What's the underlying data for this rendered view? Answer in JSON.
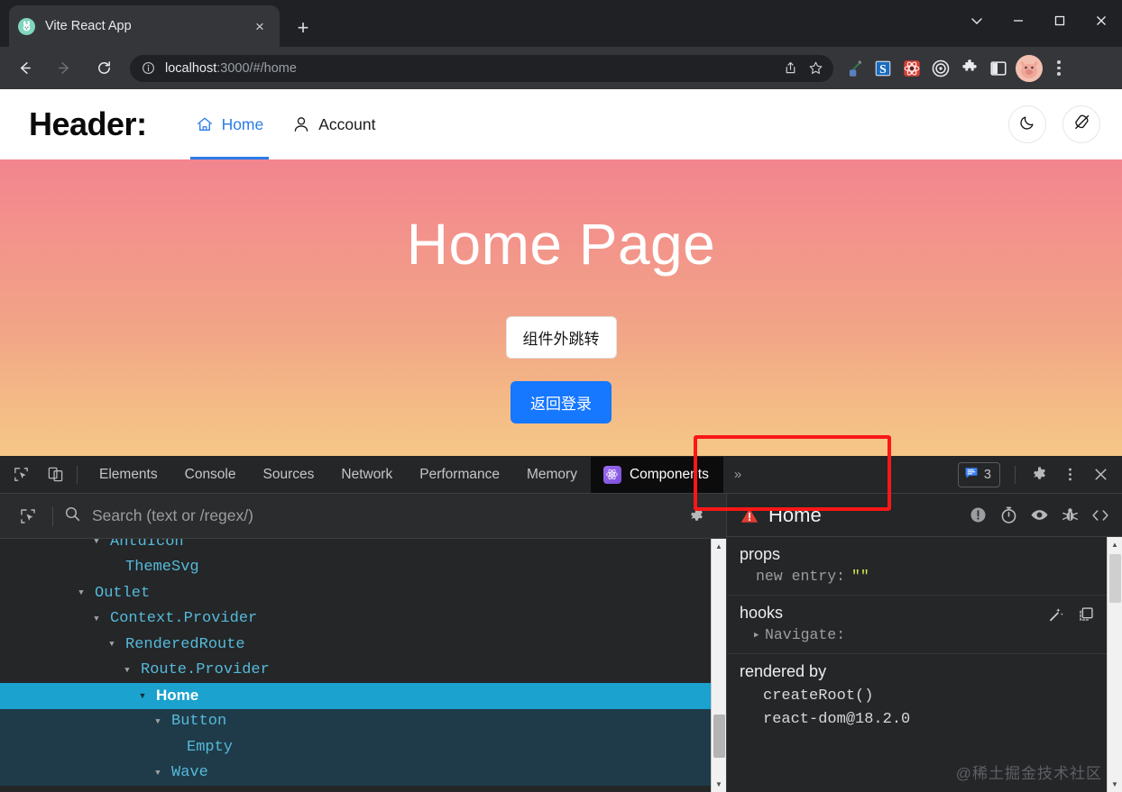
{
  "browser": {
    "tab": {
      "title": "Vite React App",
      "favicon": "rabbit-favicon",
      "close_label": "×"
    },
    "new_tab_label": "+",
    "window_controls": [
      "chevron-down",
      "minimize",
      "maximize",
      "close"
    ],
    "omnibox": {
      "url_host": "localhost",
      "url_rest": ":3000/#/home",
      "info_icon": "info-circle-icon"
    },
    "toolbar_actions": [
      "share-icon",
      "bookmark-star-icon"
    ],
    "extensions": [
      "eyedropper-icon",
      "stylus-s-icon",
      "react-devtools-icon",
      "target-icon",
      "puzzle-icon",
      "sidepanel-icon"
    ],
    "profile": "pig-avatar",
    "menu": "kebab-menu"
  },
  "app": {
    "logo": "Header:",
    "nav": [
      {
        "label": "Home",
        "icon": "home-icon",
        "active": true
      },
      {
        "label": "Account",
        "icon": "user-icon",
        "active": false
      }
    ],
    "header_actions": [
      {
        "name": "dark-mode-toggle",
        "icon": "moon-icon"
      },
      {
        "name": "theme-picker",
        "icon": "brush-icon"
      }
    ],
    "hero": {
      "title": "Home Page",
      "button_outline": "组件外跳转",
      "button_primary": "返回登录"
    },
    "colors": {
      "hero_gradient_top": "#f2858f",
      "hero_gradient_bottom": "#f5c787",
      "primary": "#1677ff",
      "nav_active": "#2b7ce8"
    }
  },
  "devtools": {
    "left_tools": [
      "inspect-element-icon",
      "device-toolbar-icon"
    ],
    "tabs": [
      "Elements",
      "Console",
      "Sources",
      "Network",
      "Performance",
      "Memory"
    ],
    "active_tab": {
      "label": "Components",
      "icon": "react-atom-icon"
    },
    "overflow_label": "»",
    "issues_count": "3",
    "right_icons": [
      "settings-gear-icon",
      "kebab-menu-icon",
      "close-icon"
    ],
    "annotation": {
      "name": "red-highlight-box",
      "color": "#fa1717"
    },
    "react": {
      "search_placeholder": "Search (text or /regex/)",
      "select_icon": "select-element-icon",
      "settings_icon": "settings-gear-icon",
      "tree": [
        {
          "label": "AntdIcon",
          "depth": 5,
          "toggle": "▾",
          "selected": false,
          "clipped": true
        },
        {
          "label": "ThemeSvg",
          "depth": 6,
          "toggle": "",
          "selected": false
        },
        {
          "label": "Outlet",
          "depth": 4,
          "toggle": "▾",
          "selected": false
        },
        {
          "label": "Context.Provider",
          "depth": 5,
          "toggle": "▾",
          "selected": false
        },
        {
          "label": "RenderedRoute",
          "depth": 6,
          "toggle": "▾",
          "selected": false
        },
        {
          "label": "Route.Provider",
          "depth": 7,
          "toggle": "▾",
          "selected": false
        },
        {
          "label": "Home",
          "depth": 8,
          "toggle": "▾",
          "selected": true
        },
        {
          "label": "Button",
          "depth": 9,
          "toggle": "▾",
          "selected": false,
          "child_of_selected": true
        },
        {
          "label": "Empty",
          "depth": 10,
          "toggle": "",
          "selected": false,
          "child_of_selected": true
        },
        {
          "label": "Wave",
          "depth": 9,
          "toggle": "▾",
          "selected": false,
          "child_of_selected": true,
          "clipped": true
        }
      ],
      "details": {
        "component_name": "Home",
        "warning_icon": "warning-triangle-icon",
        "header_icons": [
          "error-circle-icon",
          "timer-icon",
          "eye-icon",
          "bug-icon",
          "code-brackets-icon"
        ],
        "props": {
          "title": "props",
          "entry_key": "new entry:",
          "entry_value": "\"\""
        },
        "hooks": {
          "title": "hooks",
          "entry": "Navigate:",
          "icons": [
            "magic-wand-icon",
            "copy-icon"
          ]
        },
        "rendered_by": {
          "title": "rendered by",
          "lines": [
            "createRoot()",
            "react-dom@18.2.0"
          ]
        }
      },
      "watermark": "@稀土掘金技术社区"
    }
  }
}
